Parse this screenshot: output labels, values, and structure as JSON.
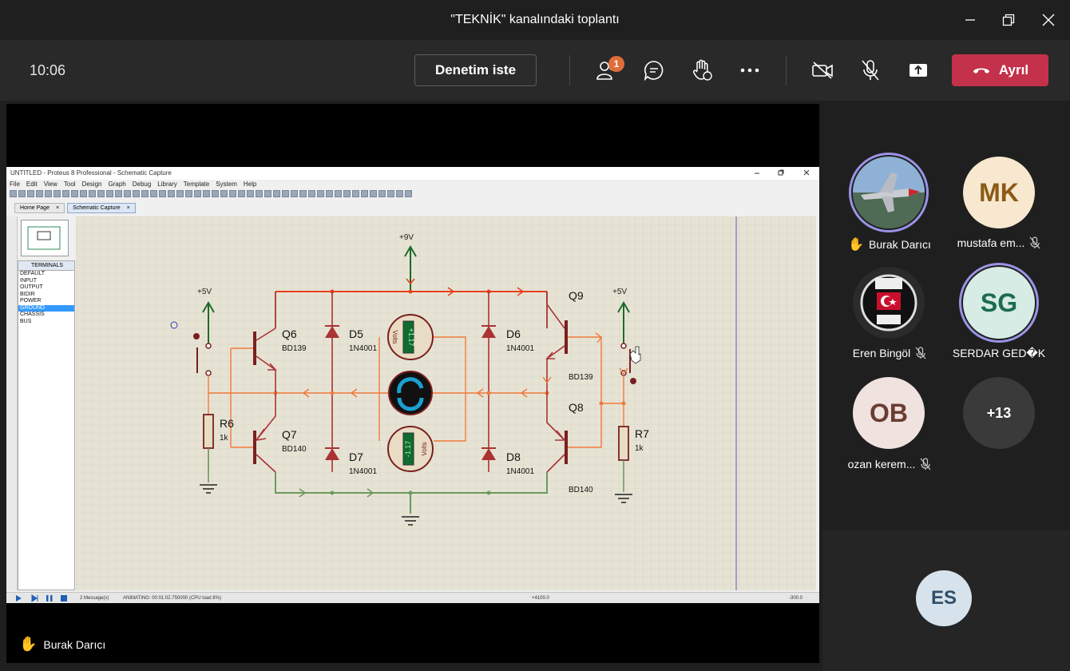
{
  "window": {
    "title": "\"TEKNİK\" kanalındaki toplantı"
  },
  "toolbar": {
    "time": "10:06",
    "request_control_label": "Denetim iste",
    "participants_badge": "1",
    "leave_label": "Ayrıl"
  },
  "presenter": {
    "name": "Burak Darıcı"
  },
  "proteus": {
    "title": "UNTITLED - Proteus 8 Professional - Schematic Capture",
    "menu": [
      "File",
      "Edit",
      "View",
      "Tool",
      "Design",
      "Graph",
      "Debug",
      "Library",
      "Template",
      "System",
      "Help"
    ],
    "tabs": [
      "Home Page",
      "Schematic Capture"
    ],
    "device_list_header": "TERMINALS",
    "device_list": [
      "DEFAULT",
      "INPUT",
      "OUTPUT",
      "BIDIR",
      "POWER",
      "GROUND",
      "CHASSIS",
      "BUS"
    ],
    "device_selected": "GROUND",
    "status_messages": "2 Message(s)",
    "status_animating": "ANIMATING: 00:01:02.750000 (CPU load 8%)",
    "status_coord_x": "+4100.0",
    "status_coord_y": "-300.0",
    "schematic_labels": {
      "supply_9v": "+9V",
      "supply_5v_left": "+5V",
      "supply_5v_right": "+5V",
      "q6": "Q6",
      "q6_type": "BD139",
      "q7": "Q7",
      "q7_type": "BD140",
      "q8": "Q8",
      "q8_type": "BD140",
      "q9": "Q9",
      "q9_type": "BD139",
      "d5": "D5",
      "d5_type": "1N4001",
      "d6": "D6",
      "d6_type": "1N4001",
      "d7": "D7",
      "d7_type": "1N4001",
      "d8": "D8",
      "d8_type": "1N4001",
      "r6": "R6",
      "r6_value": "1k",
      "r7": "R7",
      "r7_value": "1k",
      "voltmeter_top_reading": "+1.17",
      "voltmeter_bottom_reading": "-1.17",
      "volts_unit": "Volts"
    }
  },
  "participants": [
    {
      "name": "Burak Darıcı",
      "initials": "",
      "hand_raised": true,
      "muted": false,
      "speaking": true,
      "color": "#5a7ea6"
    },
    {
      "name": "mustafa em...",
      "initials": "MK",
      "hand_raised": false,
      "muted": true,
      "speaking": false,
      "color": "#f7e8cf"
    },
    {
      "name": "Eren Bingöl",
      "initials": "",
      "hand_raised": false,
      "muted": true,
      "speaking": false,
      "color": "#222222"
    },
    {
      "name": "SERDAR GED�K",
      "initials": "SG",
      "hand_raised": false,
      "muted": false,
      "speaking": true,
      "color": "#d6ece4"
    },
    {
      "name": "ozan kerem...",
      "initials": "OB",
      "hand_raised": false,
      "muted": true,
      "speaking": false,
      "color": "#f0e3df"
    },
    {
      "name": "",
      "initials": "+13",
      "hand_raised": false,
      "muted": false,
      "speaking": false,
      "color": "#3a3a3a"
    }
  ],
  "self_view": {
    "initials": "ES"
  }
}
